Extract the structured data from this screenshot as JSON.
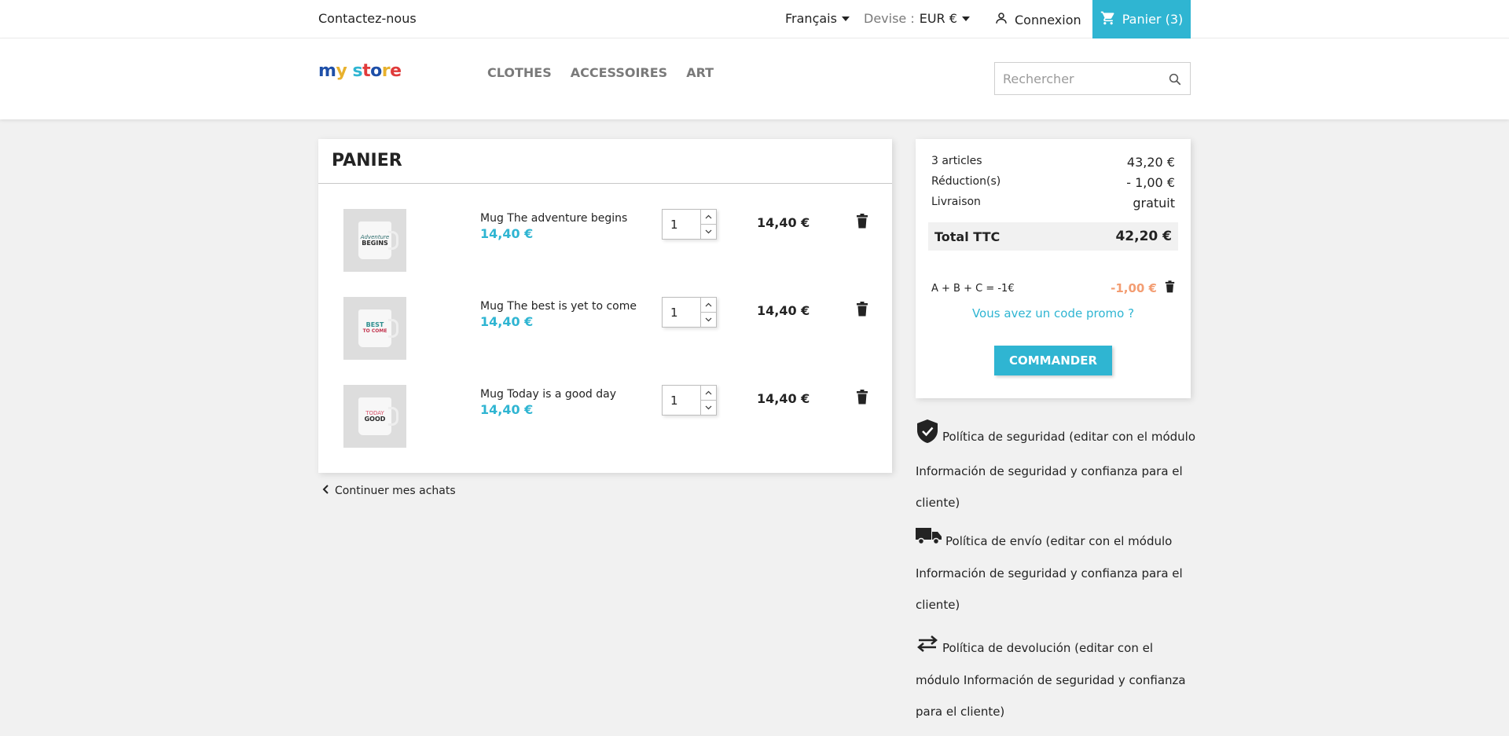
{
  "topbar": {
    "contact": "Contactez-nous",
    "language": "Français",
    "currency_label": "Devise :",
    "currency_value": "EUR €",
    "login": "Connexion",
    "cart": "Panier (3)"
  },
  "header": {
    "logo": [
      "m",
      "y",
      " ",
      "s",
      "t",
      "o",
      "r",
      "e"
    ],
    "nav": [
      "CLOTHES",
      "ACCESSOIRES",
      "ART"
    ],
    "search_placeholder": "Rechercher"
  },
  "cart": {
    "title": "PANIER",
    "items": [
      {
        "name": "Mug The adventure begins",
        "price": "14,40 €",
        "qty": "1",
        "total": "14,40 €",
        "mug_text": [
          "Adventure",
          "BEGINS"
        ],
        "mug_colors": [
          "#2f6f6f",
          "#2a2a2a"
        ]
      },
      {
        "name": "Mug The best is yet to come",
        "price": "14,40 €",
        "qty": "1",
        "total": "14,40 €",
        "mug_text": [
          "BEST",
          "TO COME"
        ],
        "mug_colors": [
          "#2f8f8f",
          "#c2334d"
        ]
      },
      {
        "name": "Mug Today is a good day",
        "price": "14,40 €",
        "qty": "1",
        "total": "14,40 €",
        "mug_text": [
          "TODAY",
          "GOOD"
        ],
        "mug_colors": [
          "#d9536b",
          "#2a2a2a"
        ]
      }
    ],
    "continue": "Continuer mes achats"
  },
  "summary": {
    "articles_label": "3 articles",
    "articles_value": "43,20 €",
    "reduction_label": "Réduction(s)",
    "reduction_value": "- 1,00 €",
    "shipping_label": "Livraison",
    "shipping_value": "gratuit",
    "total_label": "Total TTC",
    "total_value": "42,20 €",
    "promo_code": "A + B + C = -1€",
    "promo_value": "-1,00 €",
    "promo_link": "Vous avez un code promo ?",
    "order_button": "COMMANDER",
    "accent_color": "#2fb5d2",
    "promo_color": "#f39d72"
  },
  "reassurance": [
    {
      "icon": "shield-check-icon",
      "text": "Política de seguridad (editar con el módulo Información de seguridad y confianza para el cliente)"
    },
    {
      "icon": "truck-icon",
      "text": "Política de envío (editar con el módulo Información de seguridad y confianza para el cliente)"
    },
    {
      "icon": "swap-arrows-icon",
      "text": "Política de devolución (editar con el módulo Información de seguridad y confianza para el cliente)"
    }
  ]
}
